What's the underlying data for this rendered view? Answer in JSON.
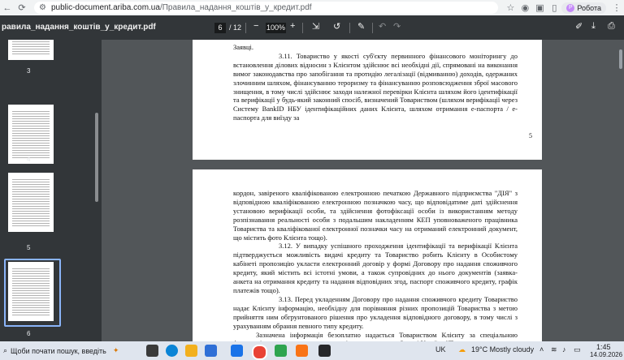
{
  "browser": {
    "url_domain": "public-document.ariba.com.ua",
    "url_path": "/Правила_надання_коштів_у_кредит.pdf",
    "profile_label": "Робота",
    "profile_initial": "Р"
  },
  "pdf_toolbar": {
    "title": "равила_надання_коштів_у_кредит.pdf",
    "current_page": "6",
    "total_pages": "/ 12",
    "zoom": "100%",
    "minus": "−",
    "plus": "+"
  },
  "thumbnails": [
    {
      "label": "3"
    },
    {
      "label": "4"
    },
    {
      "label": "5"
    },
    {
      "label": "6"
    }
  ],
  "page5": {
    "top_word": "Заявці.",
    "p311": "3.11. Товариство у якості суб'єкту первинного фінансового моніторингу до встановлення ділових відносин з Клієнтом здійснює всі необхідні дії, спрямовані на виконання вимог законодавства про запобігання та протидію легалізації (відмиванню) доходів, одержаних злочинним шляхом, фінансуванню тероризму та фінансуванню розповсюдження зброї масового знищення, в тому числі здійснює заходи належної перевірки Клієнта шляхом його ідентифікації та верифікації у будь-який законний спосіб, визначений Товариством (шляхом верифікації через Систему BankID НБУ ідентифікаційних даних Клієнта, шляхом отримання е-паспорта / е-паспорта для виїзду за",
    "page_number": "5"
  },
  "page6": {
    "p_cont": "кордон, завіреного кваліфікованою електронною печаткою Державного підприємства \"ДІЯ\" з відповідною кваліфікованою електронною позначкою часу, що відповідатиме даті здійснення установою верифікації особи, та здійснення фотофіксації особи із використанням методу розпізнавання реальності особи з подальшим накладенням КЕП уповноваженого працівника Товариства та кваліфікованої електронної позначки часу на отриманий електронний документ, що містить фото Клієнта тощо).",
    "p312": "3.12. У випадку успішного проходження ідентифікації та верифікації Клієнта підтверджується можливість видачі кредиту та Товариство робить Клієнту в Особистому кабінеті пропозицію укласти електронний договір у формі Договору про надання споживчого кредиту, який містить всі істотні умови, а також супровідних до нього документів (заявка-анкета на отримання кредиту та надання відповідних згод, паспорт споживчого кредиту, графік платежів тощо).",
    "p313": "3.13. Перед укладенням Договору про надання споживчого кредиту Товариство надає Клієнту інформацію, необхідну для порівняння різних пропозицій Товариства з метою прийняття ним обгрунтованого рішення про укладення відповідного договору, в тому числі з урахуванням обрання певного типу кредиту.",
    "p_last": "Зазначена інформація безоплатно надається Товариством Клієнту за спеціальною формою (паспорт споживчого кредиту), встановленою в Законі України \"Про споживче"
  },
  "taskbar": {
    "search_text": "Щоби почати пошук, введіть",
    "lang": "UK",
    "weather": "19°C  Mostly cloudy",
    "time": "1:45",
    "date": "14.09.2026"
  }
}
